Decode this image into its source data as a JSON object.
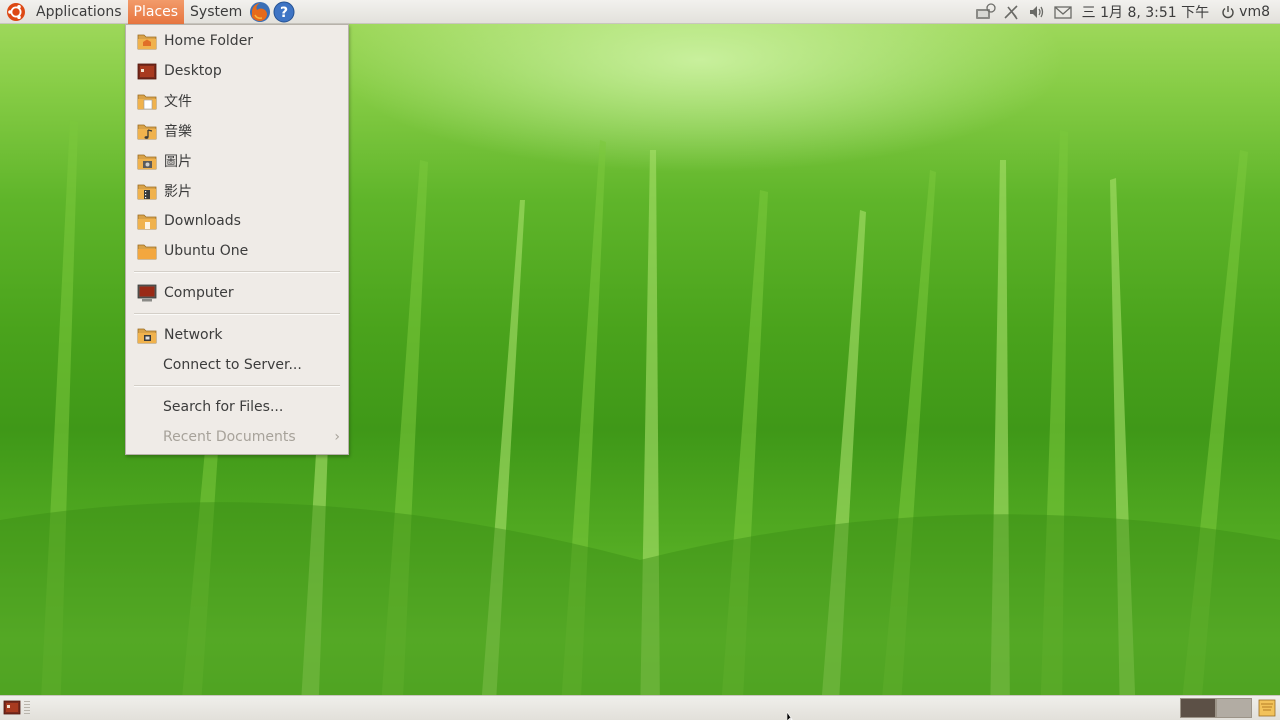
{
  "top_panel": {
    "menus": {
      "applications": "Applications",
      "places": "Places",
      "system": "System"
    },
    "launchers": [
      "firefox-icon",
      "help-icon"
    ],
    "tray": {
      "icons": [
        "network-icon",
        "bluetooth-icon",
        "volume-icon",
        "mail-icon"
      ],
      "clock": "三 1月  8,  3:51 下午",
      "user": "vm8"
    }
  },
  "places_menu": {
    "items": [
      {
        "label": "Home Folder",
        "icon": "home-folder-icon"
      },
      {
        "label": "Desktop",
        "icon": "desktop-icon"
      },
      {
        "label": "文件",
        "icon": "documents-folder-icon"
      },
      {
        "label": "音樂",
        "icon": "music-folder-icon"
      },
      {
        "label": "圖片",
        "icon": "pictures-folder-icon"
      },
      {
        "label": "影片",
        "icon": "videos-folder-icon"
      },
      {
        "label": "Downloads",
        "icon": "downloads-folder-icon"
      },
      {
        "label": "Ubuntu One",
        "icon": "ubuntu-one-folder-icon"
      }
    ],
    "computer": {
      "label": "Computer",
      "icon": "computer-icon"
    },
    "network": {
      "label": "Network",
      "icon": "network-folder-icon"
    },
    "connect": {
      "label": "Connect to Server..."
    },
    "search": {
      "label": "Search for Files..."
    },
    "recent": {
      "label": "Recent Documents",
      "disabled": true
    }
  },
  "bottom_panel": {
    "workspaces": [
      "workspace-1",
      "workspace-2"
    ]
  },
  "colors": {
    "panel": "#e3e1dc",
    "menu_bg": "#efebe7",
    "accent": "#e7753f"
  }
}
